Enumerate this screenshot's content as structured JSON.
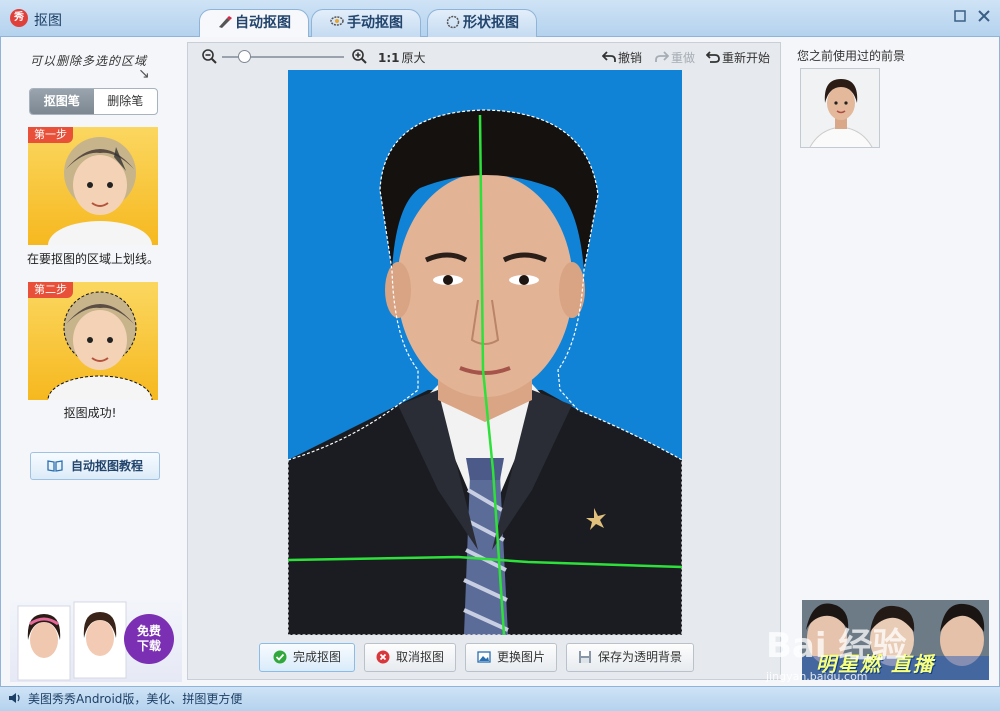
{
  "window": {
    "title": "抠图",
    "app_icon_text": "秀"
  },
  "tabs": [
    {
      "label": "自动抠图",
      "active": true
    },
    {
      "label": "手动抠图",
      "active": false
    },
    {
      "label": "形状抠图",
      "active": false
    }
  ],
  "left": {
    "hint": "可以删除多选的区域",
    "pens": [
      {
        "label": "抠图笔",
        "active": true
      },
      {
        "label": "删除笔",
        "active": false
      }
    ],
    "step1": {
      "badge": "第一步",
      "caption": "在要抠图的区域上划线。"
    },
    "step2": {
      "badge": "第二步",
      "caption": "抠图成功!"
    },
    "tutorial_label": "自动抠图教程"
  },
  "toolbar": {
    "ratio_bold": "1:1",
    "ratio_text": "原大",
    "undo": "撤销",
    "redo": "重做",
    "restart": "重新开始",
    "zoom_level": 0.15
  },
  "bottom_buttons": {
    "done": "完成抠图",
    "cancel": "取消抠图",
    "change": "更换图片",
    "save_transparent": "保存为透明背景"
  },
  "right": {
    "title": "您之前使用过的前景"
  },
  "ads": {
    "left_badge_line1": "免费",
    "left_badge_line2": "下载",
    "right_text": "明星燃 直播",
    "watermark": "Bai 经验",
    "watermark_url": "jingyan.baidu.com"
  },
  "status": {
    "text": "美图秀秀Android版，美化、拼图更方便"
  },
  "colors": {
    "photo_bg": "#1183d6",
    "selection_line": "#2ee03a",
    "accent": "#23456d"
  }
}
